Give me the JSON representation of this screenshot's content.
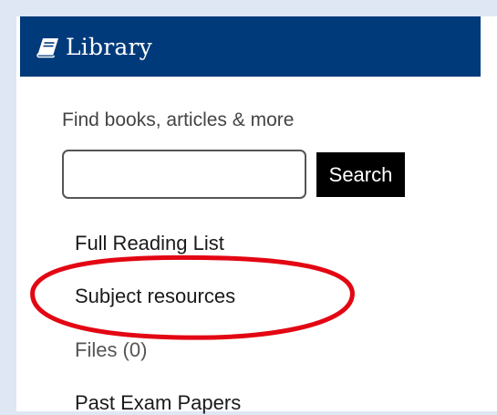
{
  "library": {
    "title": "Library",
    "search_prompt": "Find books, articles & more",
    "search_value": "",
    "search_button_label": "Search",
    "links": [
      {
        "label": "Full Reading List"
      },
      {
        "label": "Subject resources"
      },
      {
        "label": "Files (0)"
      },
      {
        "label": "Past Exam Papers"
      }
    ]
  },
  "colors": {
    "background": "#dfe6f4",
    "header": "#003a7a",
    "annotation": "#e30613"
  },
  "icons": {
    "header": "book-icon"
  }
}
